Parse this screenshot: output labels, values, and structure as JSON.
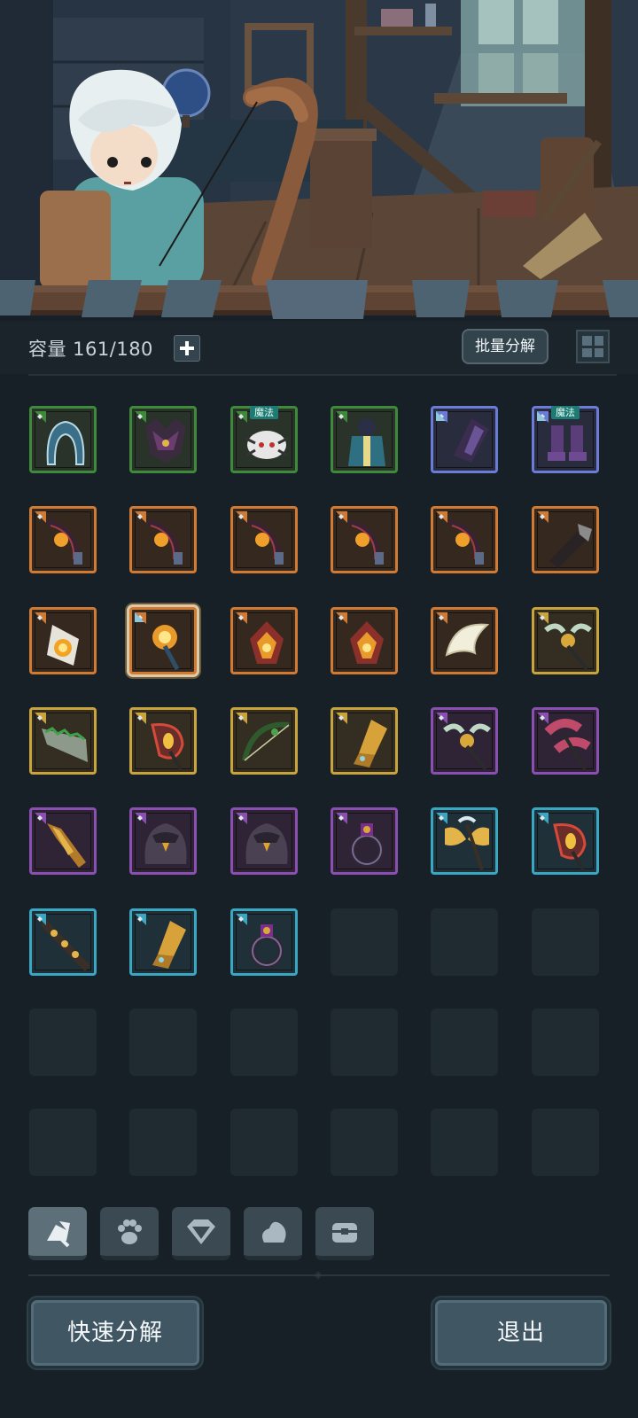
{
  "inventory": {
    "capacity_label": "容量 161/180",
    "add_glyph": "+",
    "batch_button": "批量分解"
  },
  "tag_text": "魔法",
  "rarity_colors": {
    "green": "#3f8a3a",
    "blue": "#6a7bd8",
    "orange": "#d07a34",
    "gold": "#c9a33b",
    "purple": "#8a4fb0",
    "cyan": "#3aa7c2"
  },
  "slots": [
    {
      "rarity": "green",
      "icon": "hood-icon"
    },
    {
      "rarity": "green",
      "icon": "cat-armor-icon"
    },
    {
      "rarity": "green",
      "icon": "spider-armor-icon",
      "tag": true
    },
    {
      "rarity": "green",
      "icon": "coat-icon"
    },
    {
      "rarity": "blue",
      "icon": "gauntlet-icon"
    },
    {
      "rarity": "blue",
      "icon": "boots-icon",
      "tag": true
    },
    {
      "rarity": "orange",
      "icon": "dark-bow-icon"
    },
    {
      "rarity": "orange",
      "icon": "dark-bow-icon"
    },
    {
      "rarity": "orange",
      "icon": "dark-bow-icon"
    },
    {
      "rarity": "orange",
      "icon": "dark-bow-icon"
    },
    {
      "rarity": "orange",
      "icon": "dark-bow-icon"
    },
    {
      "rarity": "orange",
      "icon": "bracer-icon"
    },
    {
      "rarity": "orange",
      "icon": "flame-gem-icon"
    },
    {
      "rarity": "orange",
      "icon": "fire-staff-icon",
      "selected": true
    },
    {
      "rarity": "orange",
      "icon": "flame-helm-icon"
    },
    {
      "rarity": "orange",
      "icon": "flame-helm-icon"
    },
    {
      "rarity": "orange",
      "icon": "wing-icon"
    },
    {
      "rarity": "gold",
      "icon": "winged-staff-icon"
    },
    {
      "rarity": "gold",
      "icon": "serrated-blade-icon"
    },
    {
      "rarity": "gold",
      "icon": "red-eye-staff-icon"
    },
    {
      "rarity": "gold",
      "icon": "vine-bow-icon"
    },
    {
      "rarity": "gold",
      "icon": "gold-gauntlet-icon"
    },
    {
      "rarity": "purple",
      "icon": "winged-staff-icon"
    },
    {
      "rarity": "purple",
      "icon": "feather-staff-icon"
    },
    {
      "rarity": "purple",
      "icon": "gold-claw-icon"
    },
    {
      "rarity": "purple",
      "icon": "owl-cloak-icon"
    },
    {
      "rarity": "purple",
      "icon": "owl-cloak-icon"
    },
    {
      "rarity": "purple",
      "icon": "ring-icon"
    },
    {
      "rarity": "cyan",
      "icon": "gold-axe-icon"
    },
    {
      "rarity": "cyan",
      "icon": "red-eye-staff-icon"
    },
    {
      "rarity": "cyan",
      "icon": "spiked-mace-icon"
    },
    {
      "rarity": "cyan",
      "icon": "gold-gauntlet-icon"
    },
    {
      "rarity": "cyan",
      "icon": "ring-icon"
    }
  ],
  "total_slots": 48,
  "tabs": [
    {
      "name": "weapon-tab-icon",
      "active": true
    },
    {
      "name": "paw-tab-icon",
      "active": false
    },
    {
      "name": "gem-tab-icon",
      "active": false
    },
    {
      "name": "ore-tab-icon",
      "active": false
    },
    {
      "name": "chest-tab-icon",
      "active": false
    }
  ],
  "footer": {
    "quick_dismantle": "快速分解",
    "exit": "退出"
  }
}
